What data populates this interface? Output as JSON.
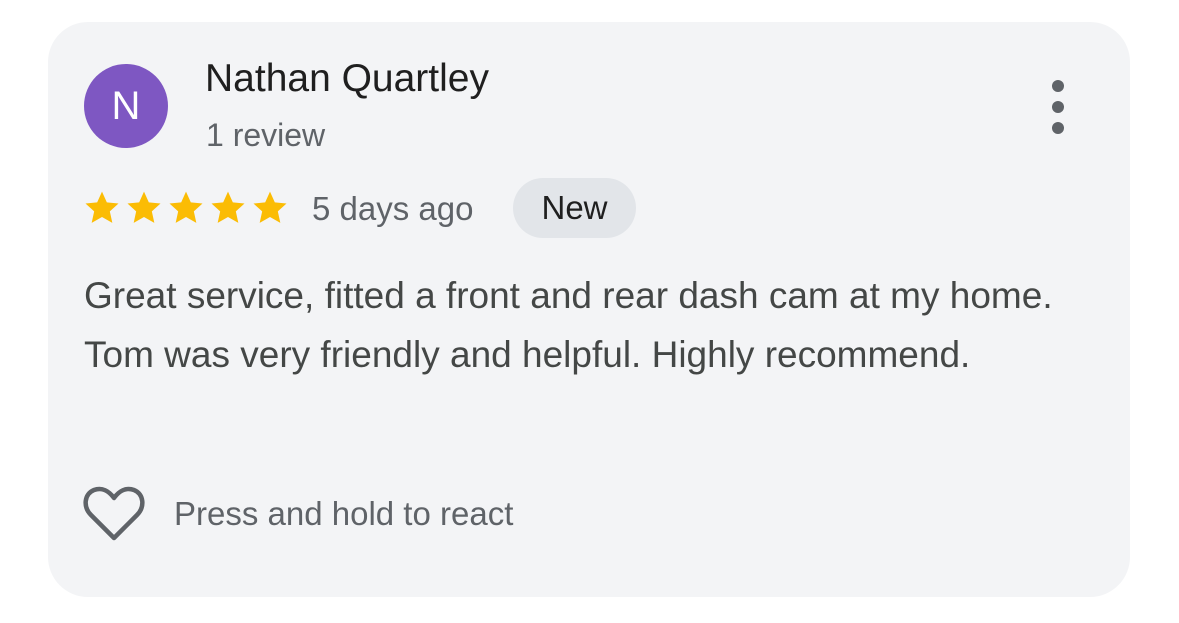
{
  "review": {
    "avatar_letter": "N",
    "reviewer_name": "Nathan Quartley",
    "review_count": "1 review",
    "rating": 5,
    "rating_max": 5,
    "date": "5 days ago",
    "badge": "New",
    "text": "Great service, fitted a front and rear dash cam at my home. Tom was very friendly and helpful. Highly recommend.",
    "react_hint": "Press and hold to react"
  },
  "icons": {
    "menu": "more-vert-icon",
    "star": "star-icon",
    "heart": "heart-outline-icon"
  },
  "colors": {
    "avatar_bg": "#7e57c2",
    "star": "#fbbc04",
    "card_bg": "#f3f4f6",
    "badge_bg": "#e2e5e9"
  }
}
